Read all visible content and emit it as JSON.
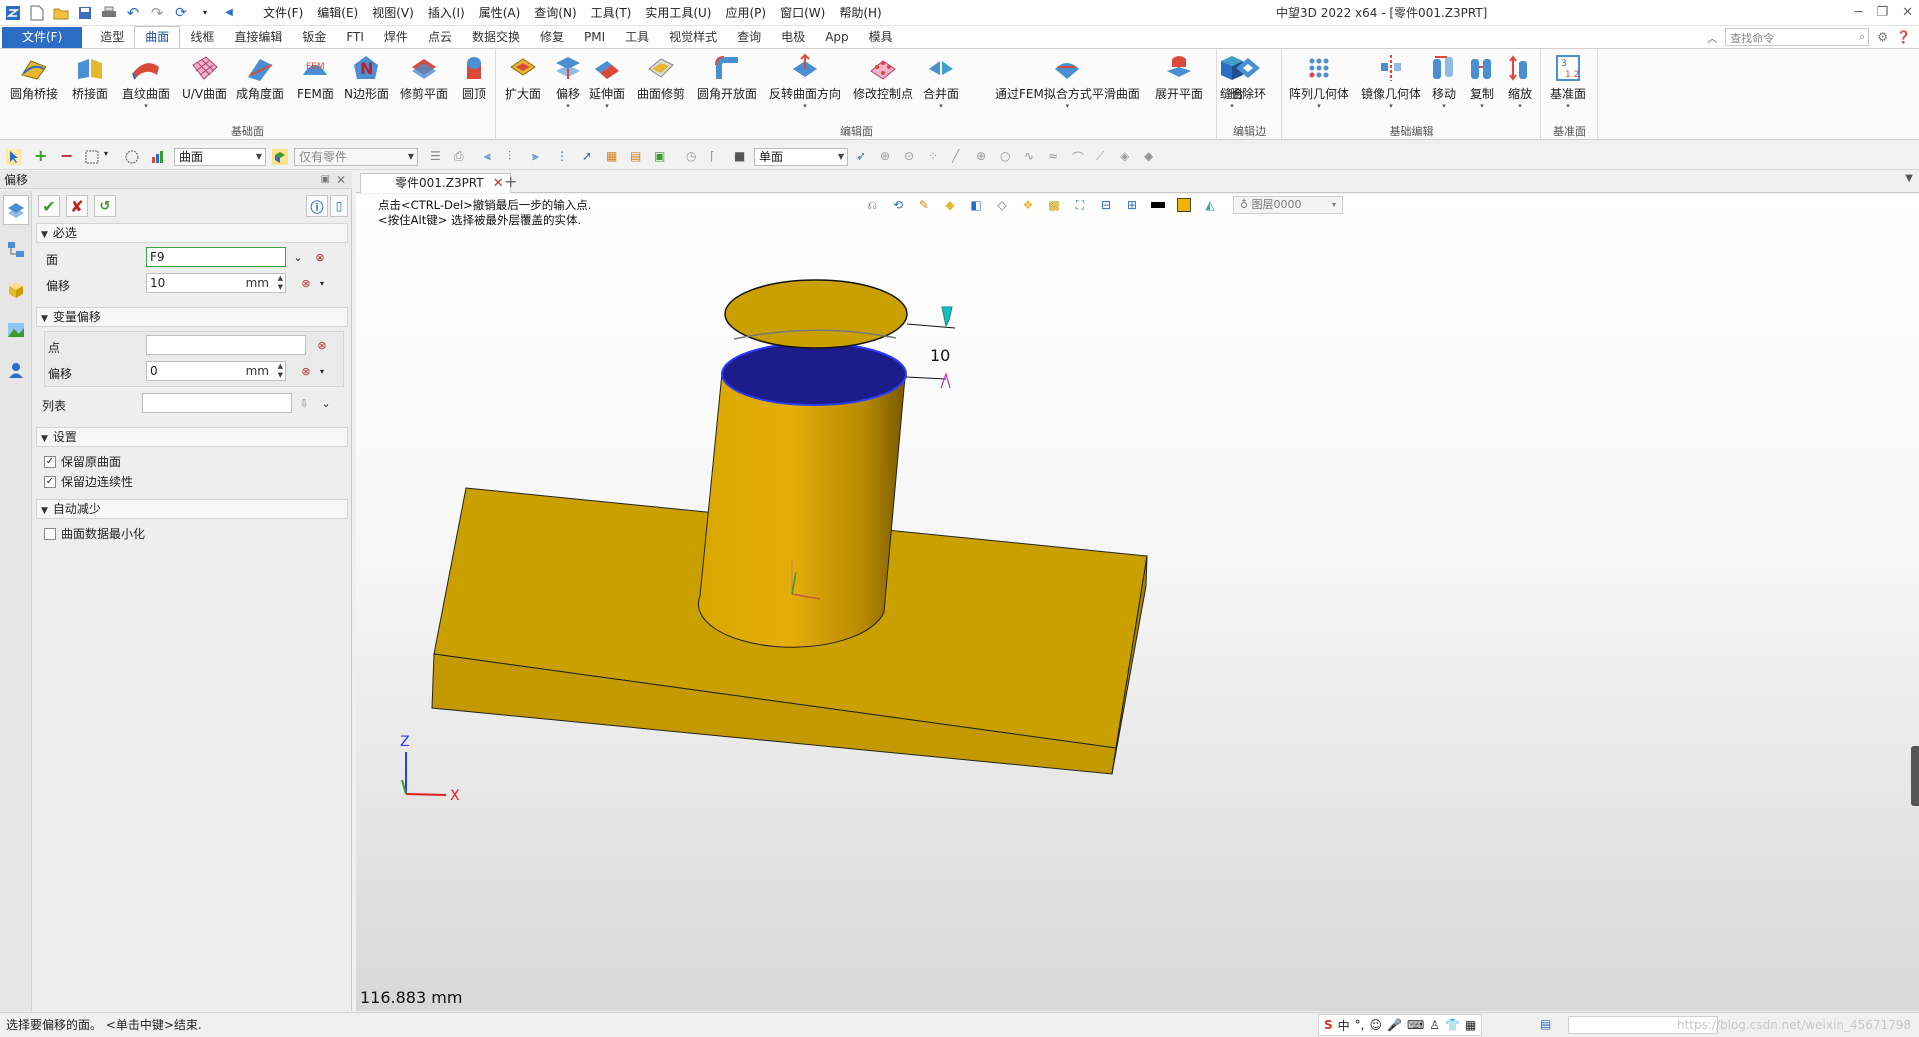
{
  "titlebar": {
    "menus": [
      "文件(F)",
      "编辑(E)",
      "视图(V)",
      "插入(I)",
      "属性(A)",
      "查询(N)",
      "工具(T)",
      "实用工具(U)",
      "应用(P)",
      "窗口(W)",
      "帮助(H)"
    ],
    "app_title": "中望3D 2022 x64 - [零件001.Z3PRT]"
  },
  "ribbon_tabs": {
    "file": "文件(F)",
    "tabs": [
      "造型",
      "曲面",
      "线框",
      "直接编辑",
      "钣金",
      "FTI",
      "焊件",
      "点云",
      "数据交换",
      "修复",
      "PMI",
      "工具",
      "视觉样式",
      "查询",
      "电极",
      "App",
      "模具"
    ],
    "active": "曲面",
    "search_placeholder": "查找命令"
  },
  "ribbon": {
    "groups": {
      "basic_surface": "基础面",
      "edit_surface": "编辑面",
      "edit_edge": "编辑边",
      "basic_edit": "基础编辑",
      "datum": "基准面"
    },
    "buttons": {
      "b1": "圆角桥接",
      "b2": "桥接面",
      "b3": "直纹曲面",
      "b4": "U/V曲面",
      "b5": "成角度面",
      "b6": "FEM面",
      "b7": "N边形面",
      "b8": "修剪平面",
      "b9": "圆顶",
      "c1": "扩大面",
      "c2": "偏移",
      "c3": "延伸面",
      "c4": "曲面修剪",
      "c5": "圆角开放面",
      "c6": "反转曲面方向",
      "c7": "修改控制点",
      "c8": "合并面",
      "c9": "通过FEM拟合方式平滑曲面",
      "c10": "展开平面",
      "c11": "缝合",
      "d1": "删除环",
      "e1": "阵列几何体",
      "e2": "镜像几何体",
      "e3": "移动",
      "e4": "复制",
      "e5": "缩放",
      "f1": "基准面"
    }
  },
  "toolbar2": {
    "filter": "曲面",
    "part_scope": "仅有零件",
    "face_mode": "单面"
  },
  "panel": {
    "title": "偏移",
    "section_required": "必选",
    "face_label": "面",
    "face_value": "F9",
    "offset_label": "偏移",
    "offset_value": "10",
    "unit": "mm",
    "section_variable": "变量偏移",
    "point_label": "点",
    "point_value": "",
    "var_offset_label": "偏移",
    "var_offset_value": "0",
    "list_label": "列表",
    "list_value": "",
    "section_settings": "设置",
    "keep_surface": "保留原曲面",
    "keep_edge_continuity": "保留边连续性",
    "section_auto_reduce": "自动减少",
    "minimize_surface_data": "曲面数据最小化"
  },
  "document": {
    "tab": "零件001.Z3PRT",
    "hint_line1": "点击<CTRL-Del>撤销最后一步的输入点.",
    "hint_line2": "<按住Alt键> 选择被最外层覆盖的实体.",
    "layer": "图层0000",
    "dimension_value": "10",
    "axis_z": "Z",
    "axis_x": "X",
    "measure": "116.883 mm"
  },
  "statusbar": {
    "message": "选择要偏移的面。 <单击中键>结束.",
    "ime_zh": "中",
    "watermark": "https://blog.csdn.net/weixin_45671798"
  },
  "colors": {
    "model": "#c9a000",
    "selected_face": "#1c1c8a",
    "file_tab": "#2b6cc4"
  }
}
